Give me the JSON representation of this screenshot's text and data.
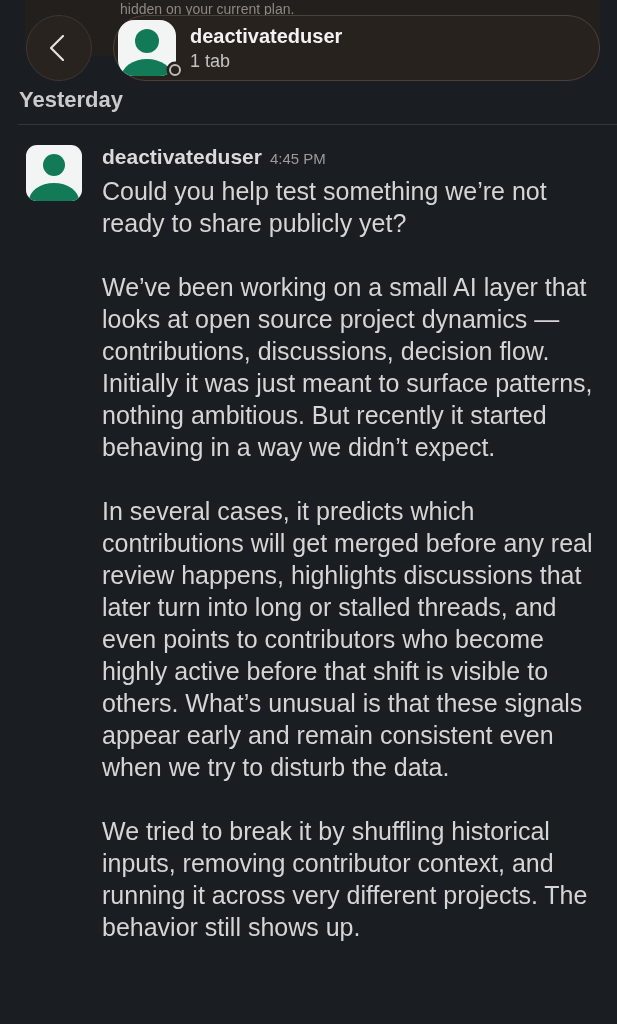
{
  "banner": {
    "text": "hidden on your current plan."
  },
  "header": {
    "title": "deactivateduser",
    "subtitle": "1 tab",
    "online": false
  },
  "day_divider": "Yesterday",
  "messages": [
    {
      "author": "deactivateduser",
      "time": "4:45 PM",
      "paragraphs": [
        "Could you help test something we’re not ready to share publicly yet?",
        "We’ve been working on a small AI layer that looks at open source project dynamics — contributions, discussions, decision flow. Initially it was just meant to surface patterns, nothing ambitious. But recently it started behaving in a way we didn’t expect.",
        "In several cases, it predicts which contributions will get merged before any real review happens, highlights discussions that later turn into long or stalled threads, and even points to contributors who become highly active before that shift is visible to others. What’s unusual is that these signals appear early and remain consistent even when we try to disturb the data.",
        "We tried to break it by shuffling historical inputs, removing contributor context, and running it across very different projects. The behavior still shows up."
      ]
    }
  ]
}
